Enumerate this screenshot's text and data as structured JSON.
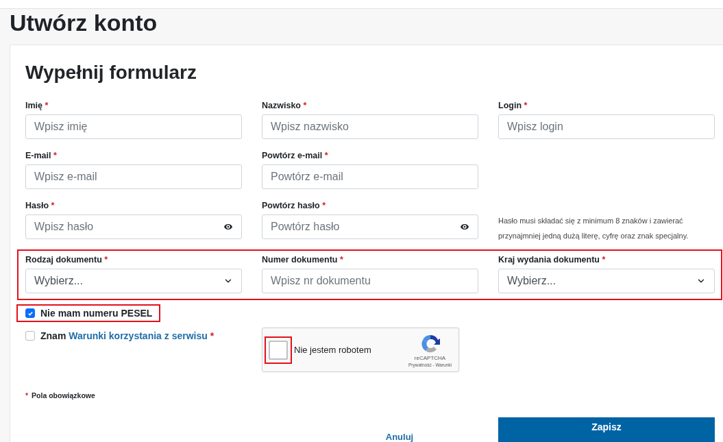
{
  "page_title": "Utwórz konto",
  "form": {
    "title": "Wypełnij formularz",
    "rows": [
      {
        "highlighted": false,
        "cells": [
          {
            "kind": "input",
            "label": "Imię",
            "mark": "*",
            "placeholder": "Wpisz imię"
          },
          {
            "kind": "input",
            "label": "Nazwisko",
            "mark": "*",
            "placeholder": "Wpisz nazwisko"
          },
          {
            "kind": "input",
            "label": "Login",
            "mark": "*",
            "placeholder": "Wpisz login"
          }
        ]
      },
      {
        "highlighted": false,
        "cells": [
          {
            "kind": "input",
            "label": "E-mail",
            "mark": "*",
            "placeholder": "Wpisz e-mail"
          },
          {
            "kind": "input",
            "label": "Powtórz e-mail",
            "mark": "*",
            "placeholder": "Powtórz e-mail"
          },
          {
            "kind": "empty"
          }
        ]
      },
      {
        "highlighted": false,
        "cells": [
          {
            "kind": "password",
            "label": "Hasło",
            "mark": "*",
            "placeholder": "Wpisz hasło"
          },
          {
            "kind": "password",
            "label": "Powtórz hasło",
            "mark": "*",
            "placeholder": "Powtórz hasło"
          },
          {
            "kind": "hint",
            "text": "Hasło musi składać się z minimum 8 znaków i zawierać przynajmniej jedną dużą literę, cyfrę oraz znak specjalny."
          }
        ]
      },
      {
        "highlighted": true,
        "cells": [
          {
            "kind": "select",
            "label": "Rodzaj dokumentu",
            "mark": "*",
            "value": "Wybierz..."
          },
          {
            "kind": "input",
            "label": "Numer dokumentu",
            "mark": "*",
            "placeholder": "Wpisz nr dokumentu"
          },
          {
            "kind": "select",
            "label": "Kraj wydania dokumentu",
            "mark": "*",
            "value": "Wybierz..."
          }
        ]
      }
    ],
    "pesel": {
      "label": "Nie mam numeru PESEL",
      "checked": true,
      "highlighted": true
    },
    "terms": {
      "prefix": "Znam",
      "link": "Warunki korzystania z serwisu",
      "mark": "*",
      "checked": false
    },
    "captcha": {
      "label": "Nie jestem robotem",
      "brand": "reCAPTCHA",
      "links": "Prywatność - Warunki",
      "checked": false,
      "highlighted": true
    },
    "required_note": {
      "mark": "*",
      "text": "Pola obowiązkowe"
    },
    "buttons": {
      "cancel": "Anuluj",
      "save": "Zapisz"
    }
  }
}
